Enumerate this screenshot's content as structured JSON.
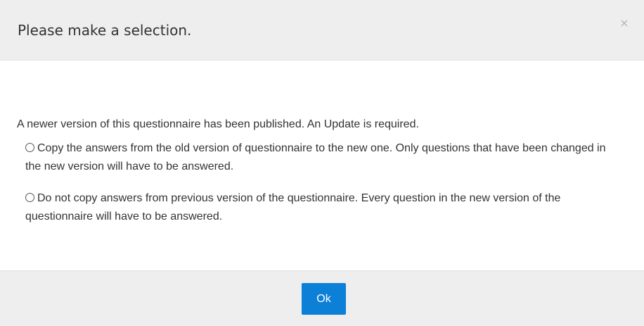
{
  "dialog": {
    "title": "Please make a selection.",
    "close_symbol": "×"
  },
  "body": {
    "intro": "A newer version of this questionnaire has been published. An Update is required.",
    "options": [
      {
        "label": "Copy the answers from the old version of questionnaire to the new one. Only questions that have been changed in the new version will have to be answered.",
        "selected": false
      },
      {
        "label": "Do not copy answers from previous version of the questionnaire. Every question in the new version of the questionnaire will have to be answered.",
        "selected": false
      }
    ]
  },
  "footer": {
    "ok_label": "Ok"
  },
  "colors": {
    "header_bg": "#eeeeee",
    "footer_bg": "#eeeeee",
    "primary_button": "#0c7fd6",
    "text": "#333333"
  }
}
